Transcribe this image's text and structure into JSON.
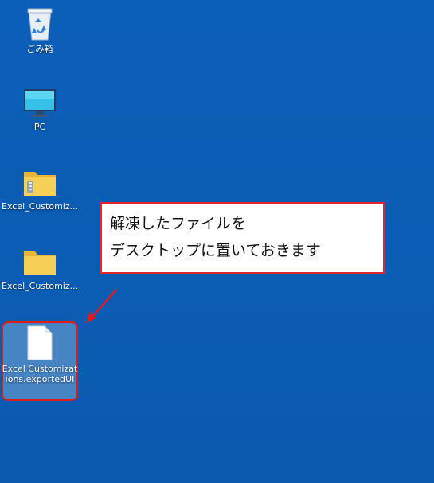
{
  "desktop": {
    "icons": [
      {
        "label": "ごみ箱",
        "icon": "recycle-bin-icon"
      },
      {
        "label": "PC",
        "icon": "monitor-icon"
      },
      {
        "label": "Excel_Customiz...",
        "icon": "zip-folder-icon"
      },
      {
        "label": "Excel_Customiz...",
        "icon": "folder-icon"
      },
      {
        "label": "Excel Customizations.exportedUI",
        "icon": "file-icon"
      }
    ]
  },
  "callout": {
    "line1": "解凍したファイルを",
    "line2": "デスクトップに置いておきます"
  },
  "colors": {
    "desktop_bg": "#0b5db4",
    "highlight_border": "#e11a1a",
    "callout_border": "#e3262a"
  }
}
